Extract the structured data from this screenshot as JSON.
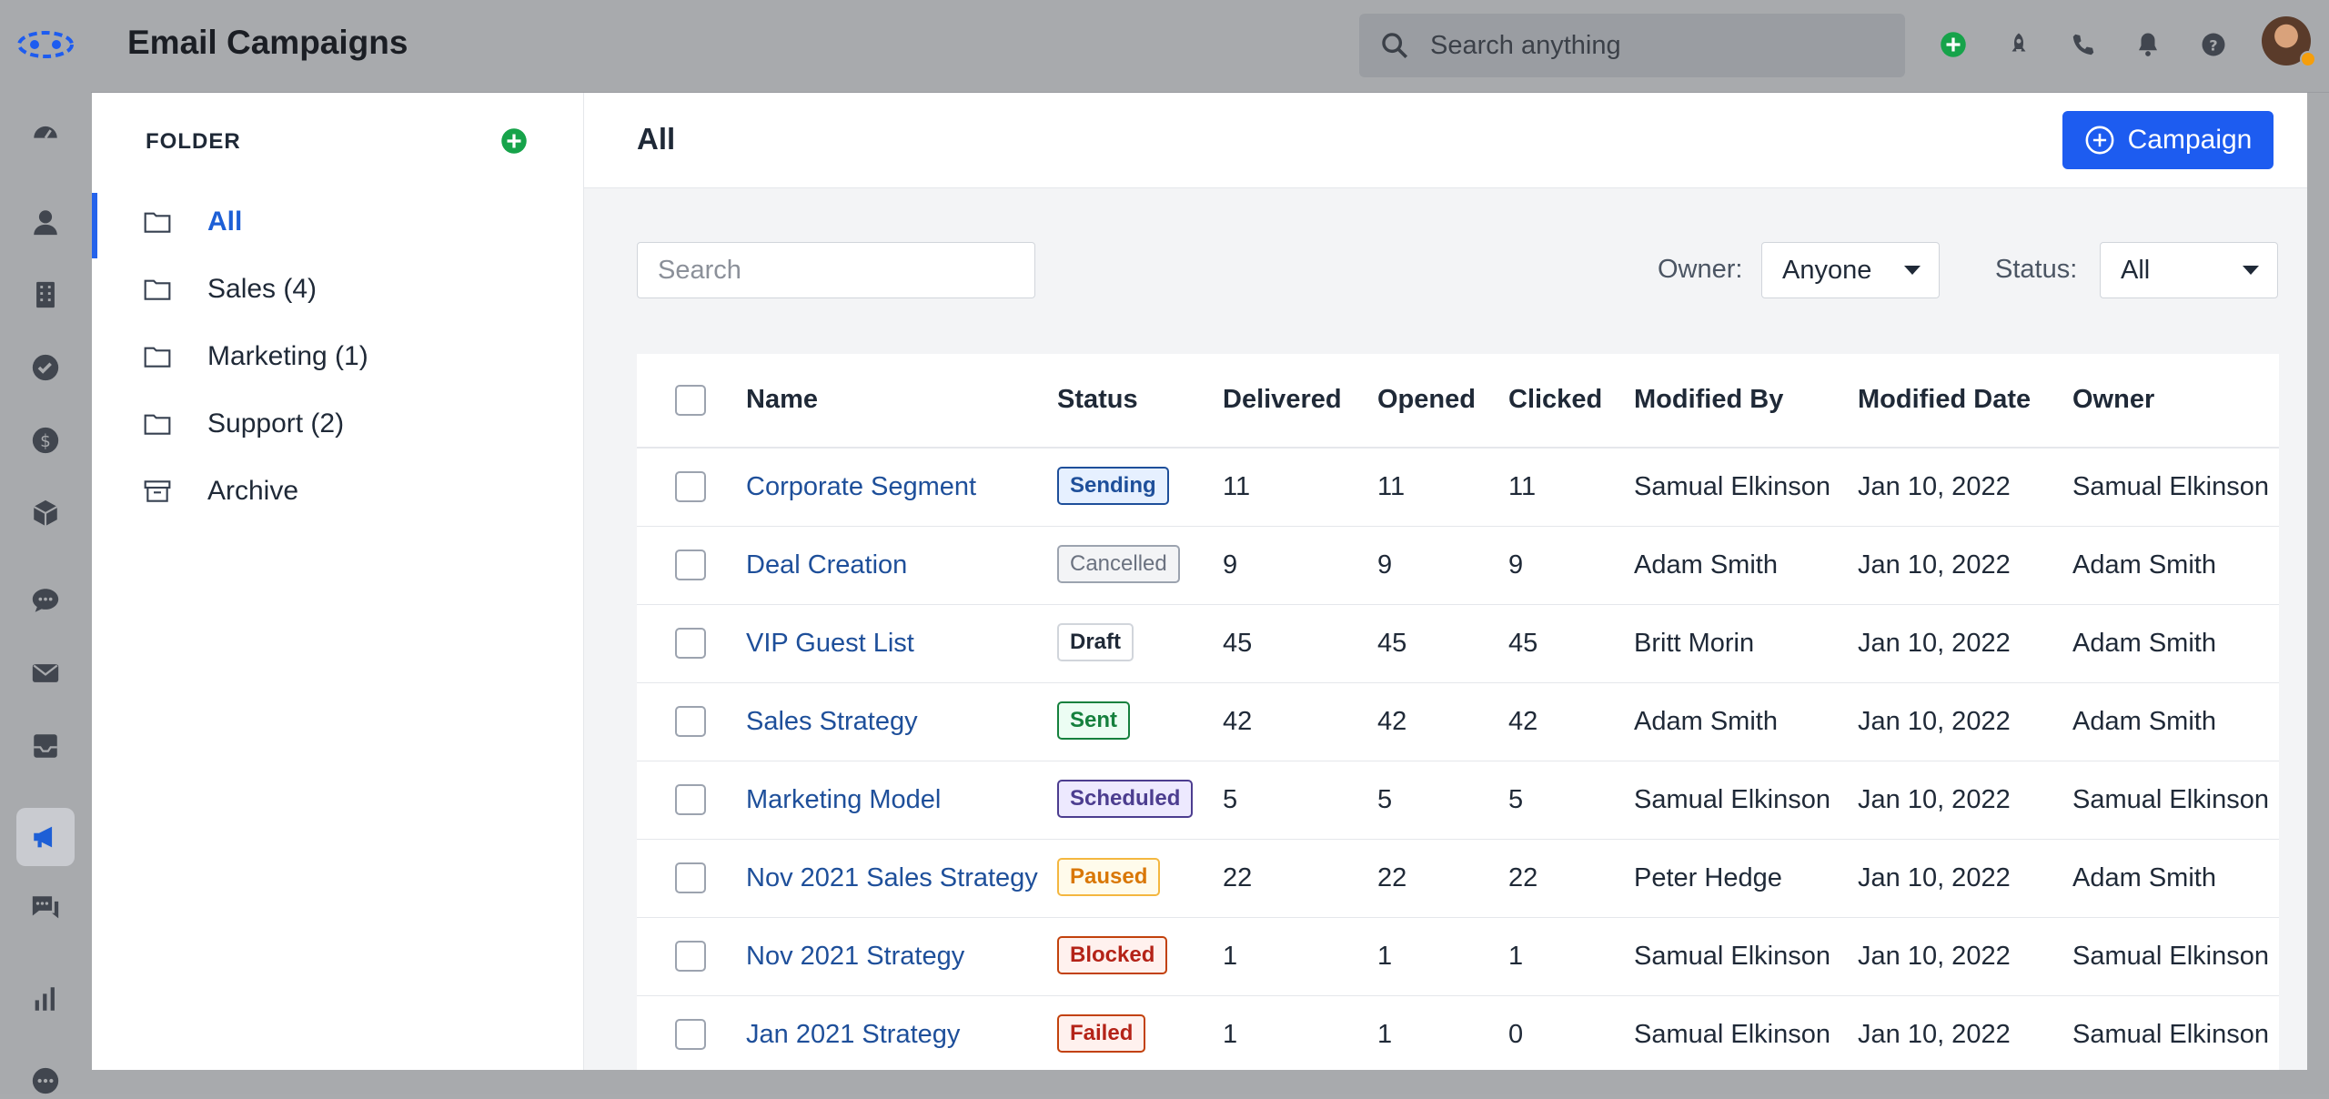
{
  "app": {
    "title": "Email Campaigns"
  },
  "global_search": {
    "placeholder": "Search anything"
  },
  "sidebar_icons": [
    "logo-icon",
    "dashboard-icon",
    "contacts-icon",
    "companies-icon",
    "tasks-icon",
    "deals-icon",
    "products-icon",
    "chat-icon",
    "email-icon",
    "inbox-icon",
    "campaigns-icon",
    "messages-icon",
    "reports-icon",
    "more-icon"
  ],
  "topbar_icons": [
    "add-icon",
    "rocket-icon",
    "phone-icon",
    "bell-icon",
    "help-icon"
  ],
  "colors": {
    "accent": "#1d5cf0",
    "add_green": "#16a34a",
    "link": "#1e4f9a"
  },
  "folders": {
    "heading": "FOLDER",
    "items": [
      {
        "label": "All",
        "active": true
      },
      {
        "label": "Sales (4)"
      },
      {
        "label": "Marketing (1)"
      },
      {
        "label": "Support (2)"
      },
      {
        "label": "Archive"
      }
    ]
  },
  "main": {
    "title": "All",
    "new_button": "Campaign",
    "search_placeholder": "Search",
    "owner_label": "Owner:",
    "owner_value": "Anyone",
    "status_label": "Status:",
    "status_value": "All"
  },
  "table": {
    "columns": [
      "Name",
      "Status",
      "Delivered",
      "Opened",
      "Clicked",
      "Modified By",
      "Modified Date",
      "Owner"
    ],
    "rows": [
      {
        "name": "Corporate Segment",
        "status": "Sending",
        "delivered": "11",
        "opened": "11",
        "clicked": "11",
        "modified_by": "Samual Elkinson",
        "modified_date": "Jan 10, 2022",
        "owner": "Samual Elkinson"
      },
      {
        "name": "Deal Creation",
        "status": "Cancelled",
        "delivered": "9",
        "opened": "9",
        "clicked": "9",
        "modified_by": "Adam Smith",
        "modified_date": "Jan 10, 2022",
        "owner": "Adam Smith"
      },
      {
        "name": "VIP Guest List",
        "status": "Draft",
        "delivered": "45",
        "opened": "45",
        "clicked": "45",
        "modified_by": "Britt Morin",
        "modified_date": "Jan 10, 2022",
        "owner": "Adam Smith"
      },
      {
        "name": "Sales Strategy",
        "status": "Sent",
        "delivered": "42",
        "opened": "42",
        "clicked": "42",
        "modified_by": "Adam Smith",
        "modified_date": "Jan 10, 2022",
        "owner": "Adam Smith"
      },
      {
        "name": "Marketing Model",
        "status": "Scheduled",
        "delivered": "5",
        "opened": "5",
        "clicked": "5",
        "modified_by": "Samual Elkinson",
        "modified_date": "Jan 10, 2022",
        "owner": "Samual Elkinson"
      },
      {
        "name": "Nov 2021 Sales Strategy",
        "status": "Paused",
        "delivered": "22",
        "opened": "22",
        "clicked": "22",
        "modified_by": "Peter Hedge",
        "modified_date": "Jan 10, 2022",
        "owner": "Adam Smith"
      },
      {
        "name": "Nov 2021 Strategy",
        "status": "Blocked",
        "delivered": "1",
        "opened": "1",
        "clicked": "1",
        "modified_by": "Samual Elkinson",
        "modified_date": "Jan 10, 2022",
        "owner": "Samual Elkinson"
      },
      {
        "name": "Jan 2021 Strategy",
        "status": "Failed",
        "delivered": "1",
        "opened": "1",
        "clicked": "0",
        "modified_by": "Samual Elkinson",
        "modified_date": "Jan 10, 2022",
        "owner": "Samual Elkinson"
      }
    ]
  }
}
